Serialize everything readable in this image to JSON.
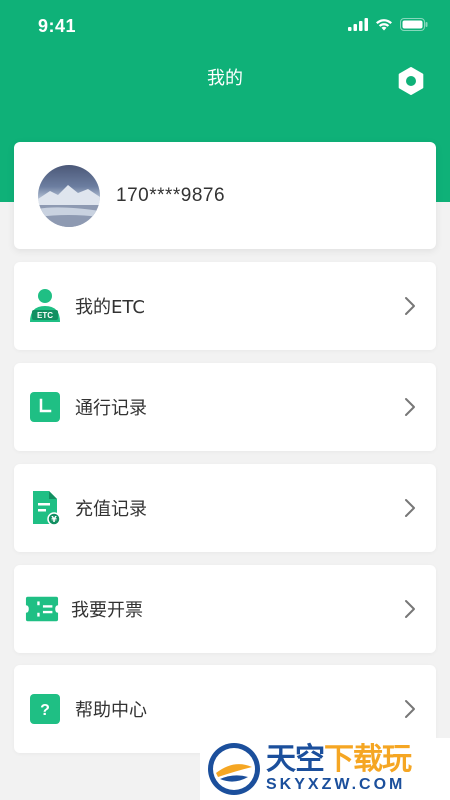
{
  "status_bar": {
    "time": "9:41"
  },
  "header": {
    "title": "我的"
  },
  "profile": {
    "phone": "170****9876"
  },
  "menu": [
    {
      "label": "我的ETC",
      "icon": "etc-user-icon",
      "icon_text": "ETC"
    },
    {
      "label": "通行记录",
      "icon": "clock-icon"
    },
    {
      "label": "充值记录",
      "icon": "recharge-document-icon",
      "icon_text": "¥"
    },
    {
      "label": "我要开票",
      "icon": "ticket-icon"
    },
    {
      "label": "帮助中心",
      "icon": "help-icon",
      "icon_text": "?"
    }
  ],
  "watermark": {
    "cn_main": "天空",
    "cn_accent": "下载玩",
    "en": "SKYXZW.COM"
  },
  "colors": {
    "brand": "#0fb178",
    "watermark_blue": "#1b4f9c",
    "watermark_orange": "#f5a623"
  }
}
